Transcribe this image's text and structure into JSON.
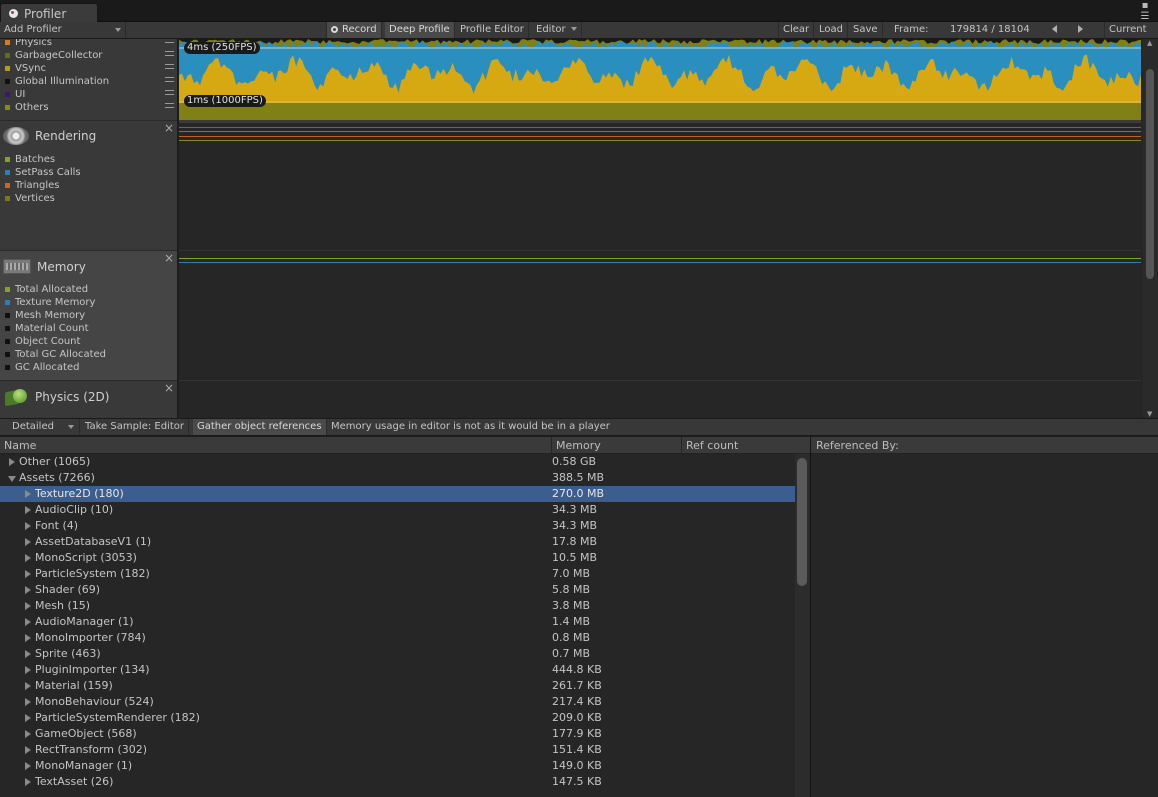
{
  "window": {
    "tab_title": "Profiler"
  },
  "toolbar": {
    "add_profiler": "Add Profiler",
    "record": "Record",
    "deep_profile": "Deep Profile",
    "profile_editor": "Profile Editor",
    "editor": "Editor",
    "clear": "Clear",
    "load": "Load",
    "save": "Save",
    "frame_label": "Frame:",
    "frame_value": "179814 / 18104",
    "current": "Current"
  },
  "cpu": {
    "legend": [
      {
        "label": "Physics",
        "color": "#e07a10"
      },
      {
        "label": "GarbageCollector",
        "color": "#6a6a10"
      },
      {
        "label": "VSync",
        "color": "#b0a010"
      },
      {
        "label": "Global Illumination",
        "color": "#101010"
      },
      {
        "label": "UI",
        "color": "#3b1a6a"
      },
      {
        "label": "Others",
        "color": "#8a8a10"
      }
    ],
    "label_4ms": "4ms (250FPS)",
    "label_1ms": "1ms (1000FPS)"
  },
  "rendering": {
    "title": "Rendering",
    "legend": [
      {
        "label": "Batches",
        "color": "#7fa61e"
      },
      {
        "label": "SetPass Calls",
        "color": "#2a7fb5"
      },
      {
        "label": "Triangles",
        "color": "#d0661a"
      },
      {
        "label": "Vertices",
        "color": "#7a7a1a"
      }
    ]
  },
  "memory": {
    "title": "Memory",
    "legend": [
      {
        "label": "Total Allocated",
        "color": "#7fa61e"
      },
      {
        "label": "Texture Memory",
        "color": "#2a7fb5"
      },
      {
        "label": "Mesh Memory",
        "color": "#101010"
      },
      {
        "label": "Material Count",
        "color": "#101010"
      },
      {
        "label": "Object Count",
        "color": "#101010"
      },
      {
        "label": "Total GC Allocated",
        "color": "#101010"
      },
      {
        "label": "GC Allocated",
        "color": "#101010"
      }
    ]
  },
  "physics2d": {
    "title": "Physics (2D)"
  },
  "bottom_toolbar": {
    "mode": "Detailed",
    "take_sample": "Take Sample: Editor",
    "gather": "Gather object references",
    "note": "Memory usage in editor is not as it would be in a player"
  },
  "table": {
    "col_name": "Name",
    "col_memory": "Memory",
    "col_refcount": "Ref count",
    "rows": [
      {
        "name": "Other (1065)",
        "memory": "0.58 GB",
        "level": 0,
        "expanded": false
      },
      {
        "name": "Assets (7266)",
        "memory": "388.5 MB",
        "level": 0,
        "expanded": true
      },
      {
        "name": "Texture2D (180)",
        "memory": "270.0 MB",
        "level": 1,
        "expanded": false,
        "selected": true
      },
      {
        "name": "AudioClip (10)",
        "memory": "34.3 MB",
        "level": 1,
        "expanded": false
      },
      {
        "name": "Font (4)",
        "memory": "34.3 MB",
        "level": 1,
        "expanded": false
      },
      {
        "name": "AssetDatabaseV1 (1)",
        "memory": "17.8 MB",
        "level": 1,
        "expanded": false
      },
      {
        "name": "MonoScript (3053)",
        "memory": "10.5 MB",
        "level": 1,
        "expanded": false
      },
      {
        "name": "ParticleSystem (182)",
        "memory": "7.0 MB",
        "level": 1,
        "expanded": false
      },
      {
        "name": "Shader (69)",
        "memory": "5.8 MB",
        "level": 1,
        "expanded": false
      },
      {
        "name": "Mesh (15)",
        "memory": "3.8 MB",
        "level": 1,
        "expanded": false
      },
      {
        "name": "AudioManager (1)",
        "memory": "1.4 MB",
        "level": 1,
        "expanded": false
      },
      {
        "name": "MonoImporter (784)",
        "memory": "0.8 MB",
        "level": 1,
        "expanded": false
      },
      {
        "name": "Sprite (463)",
        "memory": "0.7 MB",
        "level": 1,
        "expanded": false
      },
      {
        "name": "PluginImporter (134)",
        "memory": "444.8 KB",
        "level": 1,
        "expanded": false
      },
      {
        "name": "Material (159)",
        "memory": "261.7 KB",
        "level": 1,
        "expanded": false
      },
      {
        "name": "MonoBehaviour (524)",
        "memory": "217.4 KB",
        "level": 1,
        "expanded": false
      },
      {
        "name": "ParticleSystemRenderer (182)",
        "memory": "209.0 KB",
        "level": 1,
        "expanded": false
      },
      {
        "name": "GameObject (568)",
        "memory": "177.9 KB",
        "level": 1,
        "expanded": false
      },
      {
        "name": "RectTransform (302)",
        "memory": "151.4 KB",
        "level": 1,
        "expanded": false
      },
      {
        "name": "MonoManager (1)",
        "memory": "149.0 KB",
        "level": 1,
        "expanded": false
      },
      {
        "name": "TextAsset (26)",
        "memory": "147.5 KB",
        "level": 1,
        "expanded": false
      }
    ]
  },
  "referenced_by": {
    "title": "Referenced By:"
  }
}
